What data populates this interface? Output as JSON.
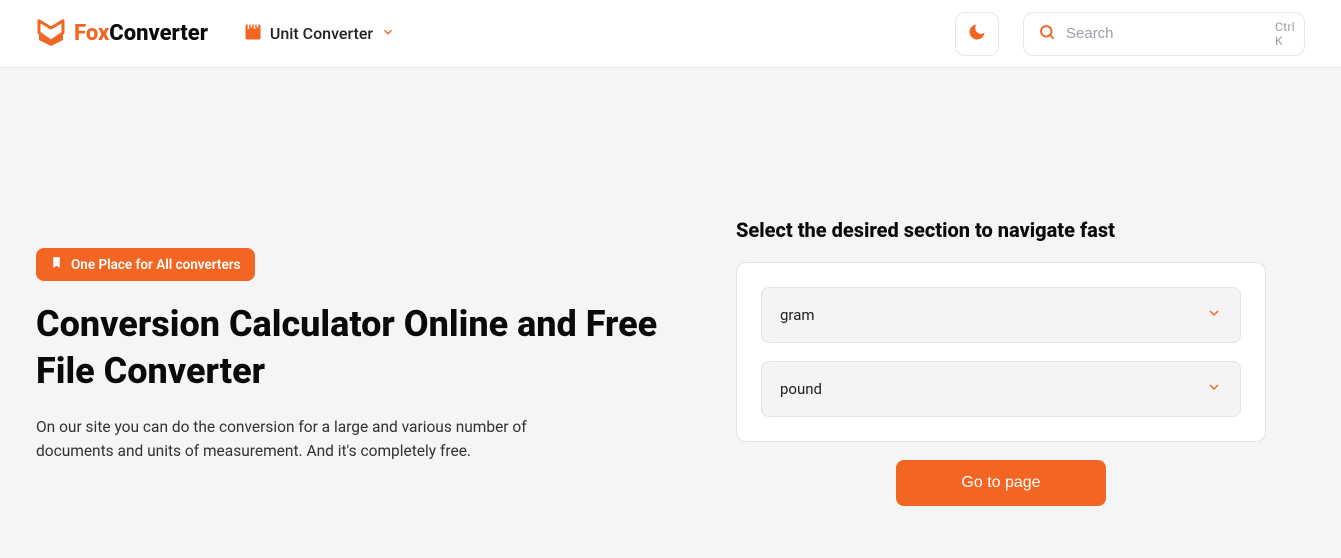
{
  "brand": {
    "first": "Fox",
    "second": "Converter"
  },
  "nav": {
    "label": "Unit Converter"
  },
  "search": {
    "placeholder": "Search",
    "shortcut": "Ctrl K"
  },
  "hero": {
    "badge": "One Place for All converters",
    "title": "Conversion Calculator Online and Free File Converter",
    "subtitle": "On our site you can do the conversion for a large and various number of documents and units of measurement. And it's completely free."
  },
  "quicknav": {
    "heading": "Select the desired section to navigate fast",
    "from": "gram",
    "to": "pound",
    "button": "Go to page"
  }
}
